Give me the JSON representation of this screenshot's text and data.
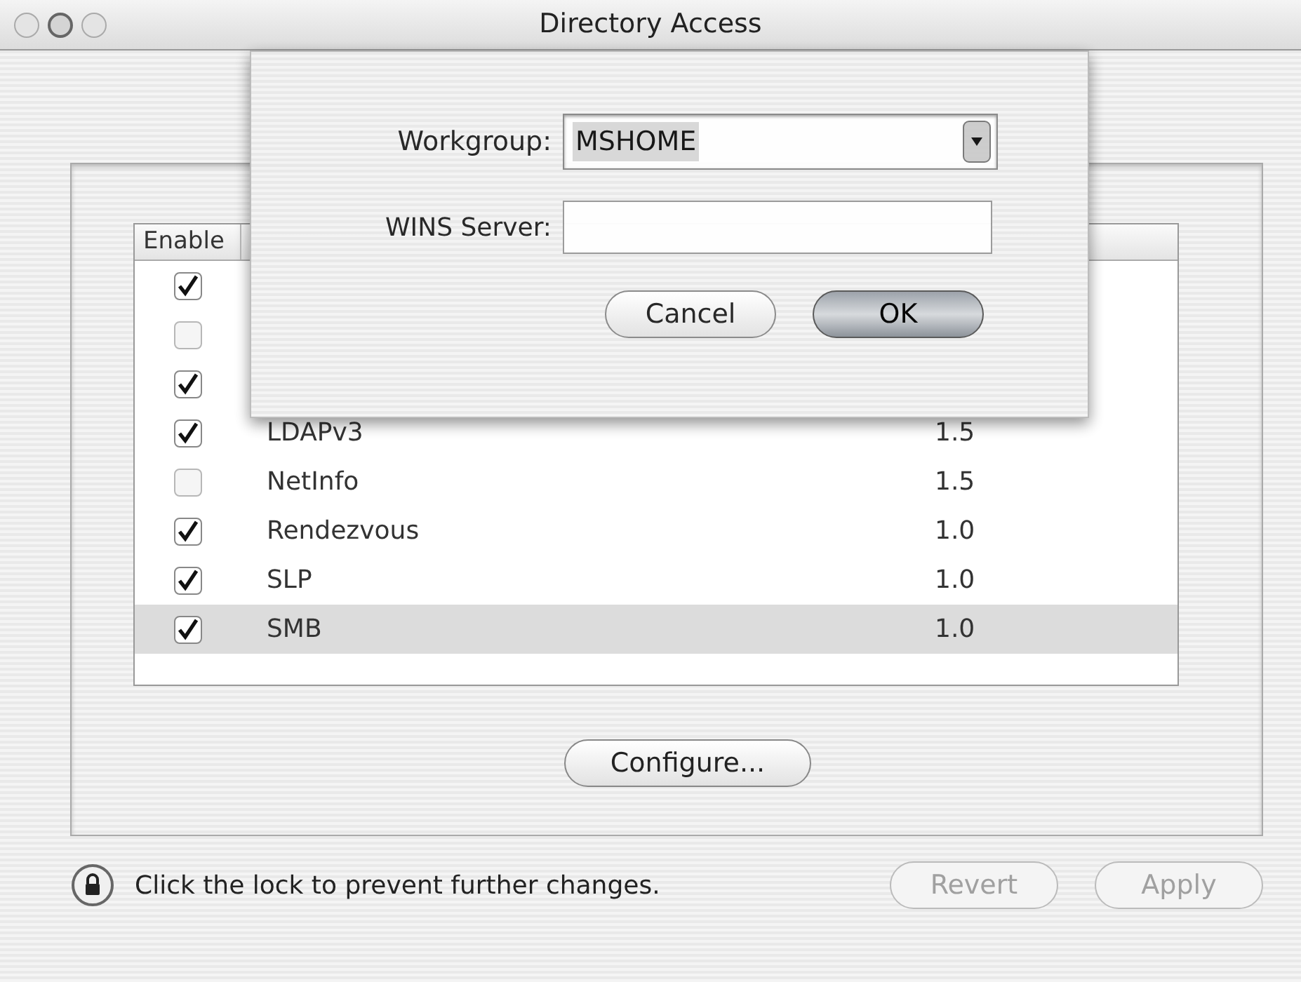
{
  "window": {
    "title": "Directory Access"
  },
  "table": {
    "columns": [
      "Enable"
    ],
    "rows": [
      {
        "enabled": true,
        "selected": false
      },
      {
        "enabled": false,
        "selected": false
      },
      {
        "enabled": true,
        "selected": false
      },
      {
        "enabled": true,
        "name": "LDAPv3",
        "version": "1.5",
        "selected": false
      },
      {
        "enabled": false,
        "name": "NetInfo",
        "version": "1.5",
        "selected": false
      },
      {
        "enabled": true,
        "name": "Rendezvous",
        "version": "1.0",
        "selected": false
      },
      {
        "enabled": true,
        "name": "SLP",
        "version": "1.0",
        "selected": false
      },
      {
        "enabled": true,
        "name": "SMB",
        "version": "1.0",
        "selected": true
      }
    ]
  },
  "configure_button": {
    "label": "Configure...",
    "disabled": false
  },
  "footer": {
    "lock_text": "Click the lock to prevent further changes.",
    "buttons": [
      {
        "label": "Revert",
        "disabled": true
      },
      {
        "label": "Apply",
        "disabled": true
      }
    ]
  },
  "sheet": {
    "workgroup": {
      "label": "Workgroup:",
      "value": "MSHOME"
    },
    "wins": {
      "label": "WINS Server:"
    },
    "buttons": [
      {
        "label": "Cancel",
        "kind": "normal"
      },
      {
        "label": "OK",
        "kind": "default"
      }
    ]
  }
}
